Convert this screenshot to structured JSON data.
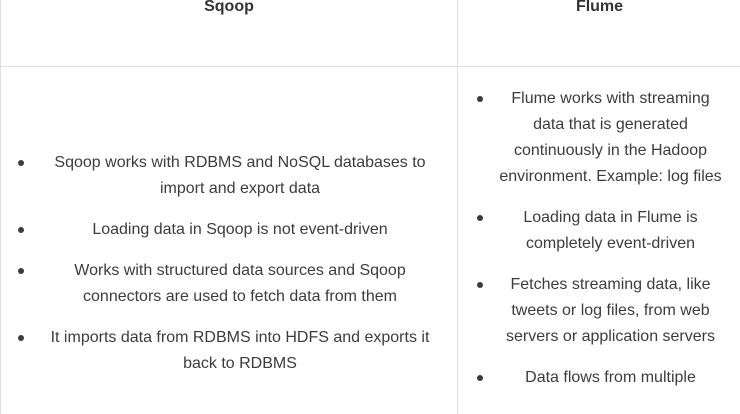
{
  "table": {
    "headers": [
      "Sqoop",
      "Flume"
    ],
    "sqoop_items": [
      "Sqoop works with RDBMS and NoSQL databases to import and export data",
      "Loading data in Sqoop is not event-driven",
      "Works with structured data sources and Sqoop connectors are used to fetch data from them",
      "It imports data from RDBMS into HDFS and exports it back to RDBMS"
    ],
    "flume_items": [
      "Flume works with streaming data that is generated continuously in the Hadoop environment. Example: log files",
      "Loading data in Flume is completely event-driven",
      "Fetches streaming data, like tweets or log files, from web servers or application servers",
      "Data flows from multiple"
    ]
  }
}
